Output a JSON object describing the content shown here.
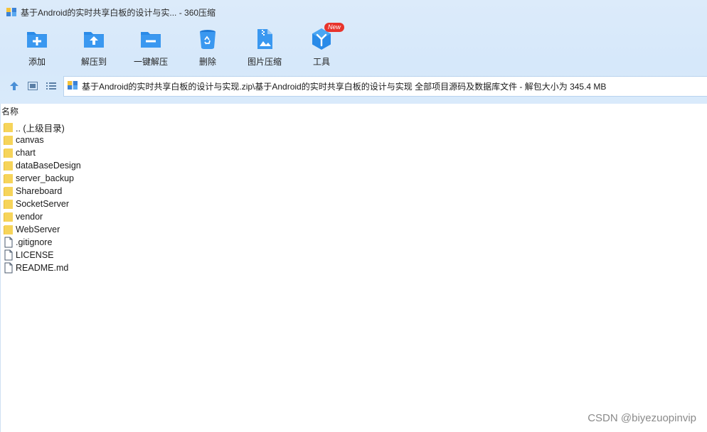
{
  "window": {
    "title": "基于Android的实时共享白板的设计与实... - 360压缩",
    "icon": "archive-app-icon"
  },
  "toolbar": {
    "items": [
      {
        "label": "添加",
        "icon": "add-folder-icon"
      },
      {
        "label": "解压到",
        "icon": "extract-to-folder-icon"
      },
      {
        "label": "一键解压",
        "icon": "quick-extract-folder-icon"
      },
      {
        "label": "删除",
        "icon": "recycle-bin-icon"
      },
      {
        "label": "图片压缩",
        "icon": "image-compress-icon"
      },
      {
        "label": "工具",
        "icon": "tools-cube-icon",
        "badge": "New"
      }
    ]
  },
  "nav": {
    "up_icon": "arrow-up-icon",
    "thumbnail_view_icon": "thumbnail-view-icon",
    "list_view_icon": "list-view-icon"
  },
  "address": {
    "path": "基于Android的实时共享白板的设计与实现.zip\\基于Android的实时共享白板的设计与实现 全部项目源码及数据库文件 - 解包大小为 345.4 MB"
  },
  "file_list": {
    "column_header": "名称",
    "items": [
      {
        "name": ".. (上级目录)",
        "type": "folder"
      },
      {
        "name": "canvas",
        "type": "folder"
      },
      {
        "name": "chart",
        "type": "folder"
      },
      {
        "name": "dataBaseDesign",
        "type": "folder"
      },
      {
        "name": "server_backup",
        "type": "folder"
      },
      {
        "name": "Shareboard",
        "type": "folder"
      },
      {
        "name": "SocketServer",
        "type": "folder"
      },
      {
        "name": "vendor",
        "type": "folder"
      },
      {
        "name": "WebServer",
        "type": "folder"
      },
      {
        "name": ".gitignore",
        "type": "file"
      },
      {
        "name": "LICENSE",
        "type": "file"
      },
      {
        "name": "README.md",
        "type": "file"
      }
    ]
  },
  "watermark": "CSDN @biyezuopinvip",
  "colors": {
    "accent": "#2a8be8",
    "folder": "#f6d45a",
    "badge": "#e8342c",
    "toolbar_bg": "#d6e8fa"
  }
}
